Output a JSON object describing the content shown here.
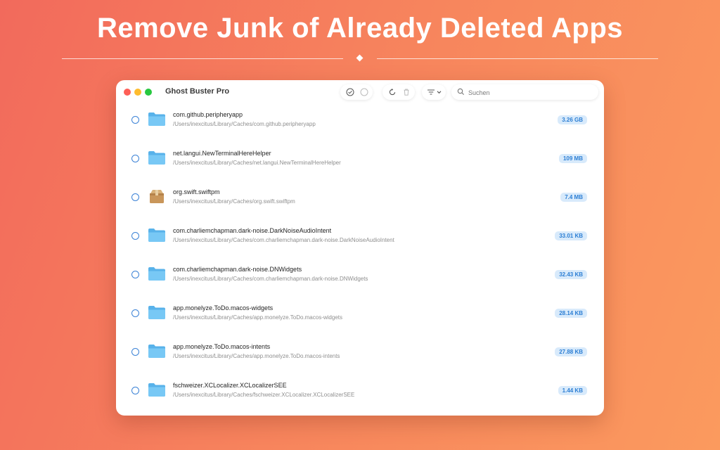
{
  "headline": "Remove Junk of Already Deleted Apps",
  "app": {
    "title": "Ghost Buster Pro"
  },
  "toolbar": {
    "icons": [
      "check-circle-icon",
      "empty-circle-icon",
      "refresh-icon",
      "trash-icon",
      "filter-icon",
      "chevron-down-icon"
    ]
  },
  "search": {
    "placeholder": "Suchen",
    "value": ""
  },
  "colors": {
    "accent": "#3b82d6",
    "badge_bg": "#d8eafb",
    "badge_text": "#2d7fd4",
    "background_start": "#f26a5c",
    "background_end": "#fb9a5e"
  },
  "items": [
    {
      "name": "com.github.peripheryapp",
      "path": "/Users/inexcitus/Library/Caches/com.github.peripheryapp",
      "size": "3.26 GB",
      "icon": "folder-icon"
    },
    {
      "name": "net.langui.NewTerminalHereHelper",
      "path": "/Users/inexcitus/Library/Caches/net.langui.NewTerminalHereHelper",
      "size": "109 MB",
      "icon": "folder-icon"
    },
    {
      "name": "org.swift.swiftpm",
      "path": "/Users/inexcitus/Library/Caches/org.swift.swiftpm",
      "size": "7.4 MB",
      "icon": "package-icon"
    },
    {
      "name": "com.charliemchapman.dark-noise.DarkNoiseAudioIntent",
      "path": "/Users/inexcitus/Library/Caches/com.charliemchapman.dark-noise.DarkNoiseAudioIntent",
      "size": "33.01 KB",
      "icon": "folder-icon"
    },
    {
      "name": "com.charliemchapman.dark-noise.DNWidgets",
      "path": "/Users/inexcitus/Library/Caches/com.charliemchapman.dark-noise.DNWidgets",
      "size": "32.43 KB",
      "icon": "folder-icon"
    },
    {
      "name": "app.monelyze.ToDo.macos-widgets",
      "path": "/Users/inexcitus/Library/Caches/app.monelyze.ToDo.macos-widgets",
      "size": "28.14 KB",
      "icon": "folder-icon"
    },
    {
      "name": "app.monelyze.ToDo.macos-intents",
      "path": "/Users/inexcitus/Library/Caches/app.monelyze.ToDo.macos-intents",
      "size": "27.88 KB",
      "icon": "folder-icon"
    },
    {
      "name": "fschweizer.XCLocalizer.XCLocalizerSEE",
      "path": "/Users/inexcitus/Library/Caches/fschweizer.XCLocalizer.XCLocalizerSEE",
      "size": "1.44 KB",
      "icon": "folder-icon"
    }
  ]
}
